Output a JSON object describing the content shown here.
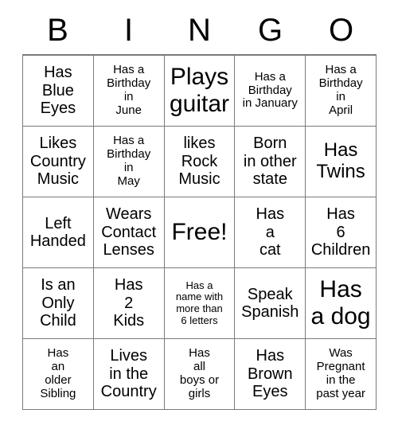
{
  "card": {
    "title": "BINGO",
    "header_letters": [
      "B",
      "I",
      "N",
      "G",
      "O"
    ],
    "rows": 5,
    "columns": 5,
    "border_color": "#7a7a7a",
    "text_color": "#000000",
    "background_color": "#ffffff"
  },
  "grid": [
    [
      {
        "text": "Has\nBlue\nEyes",
        "size": "md",
        "free": false
      },
      {
        "text": "Has a\nBirthday\nin\nJune",
        "size": "sm",
        "free": false
      },
      {
        "text": "Plays\nguitar",
        "size": "xl",
        "free": false
      },
      {
        "text": "Has a\nBirthday\nin January",
        "size": "sm",
        "free": false
      },
      {
        "text": "Has a\nBirthday\nin\nApril",
        "size": "sm",
        "free": false
      }
    ],
    [
      {
        "text": "Likes\nCountry\nMusic",
        "size": "md",
        "free": false
      },
      {
        "text": "Has a\nBirthday\nin\nMay",
        "size": "sm",
        "free": false
      },
      {
        "text": "likes\nRock\nMusic",
        "size": "md",
        "free": false
      },
      {
        "text": "Born\nin other\nstate",
        "size": "md",
        "free": false
      },
      {
        "text": "Has\nTwins",
        "size": "lg",
        "free": false
      }
    ],
    [
      {
        "text": "Left\nHanded",
        "size": "md",
        "free": false
      },
      {
        "text": "Wears\nContact\nLenses",
        "size": "md",
        "free": false
      },
      {
        "text": "Free!",
        "size": "xl",
        "free": true
      },
      {
        "text": "Has\na\ncat",
        "size": "md",
        "free": false
      },
      {
        "text": "Has\n6\nChildren",
        "size": "md",
        "free": false
      }
    ],
    [
      {
        "text": "Is an\nOnly\nChild",
        "size": "md",
        "free": false
      },
      {
        "text": "Has\n2\nKids",
        "size": "md",
        "free": false
      },
      {
        "text": "Has a\nname with\nmore than\n6 letters",
        "size": "xs",
        "free": false
      },
      {
        "text": "Speak\nSpanish",
        "size": "md",
        "free": false
      },
      {
        "text": "Has\na dog",
        "size": "xl",
        "free": false
      }
    ],
    [
      {
        "text": "Has\nan\nolder\nSibling",
        "size": "sm",
        "free": false
      },
      {
        "text": "Lives\nin the\nCountry",
        "size": "md",
        "free": false
      },
      {
        "text": "Has\nall\nboys or\ngirls",
        "size": "sm",
        "free": false
      },
      {
        "text": "Has\nBrown\nEyes",
        "size": "md",
        "free": false
      },
      {
        "text": "Was\nPregnant\nin the\npast year",
        "size": "sm",
        "free": false
      }
    ]
  ]
}
